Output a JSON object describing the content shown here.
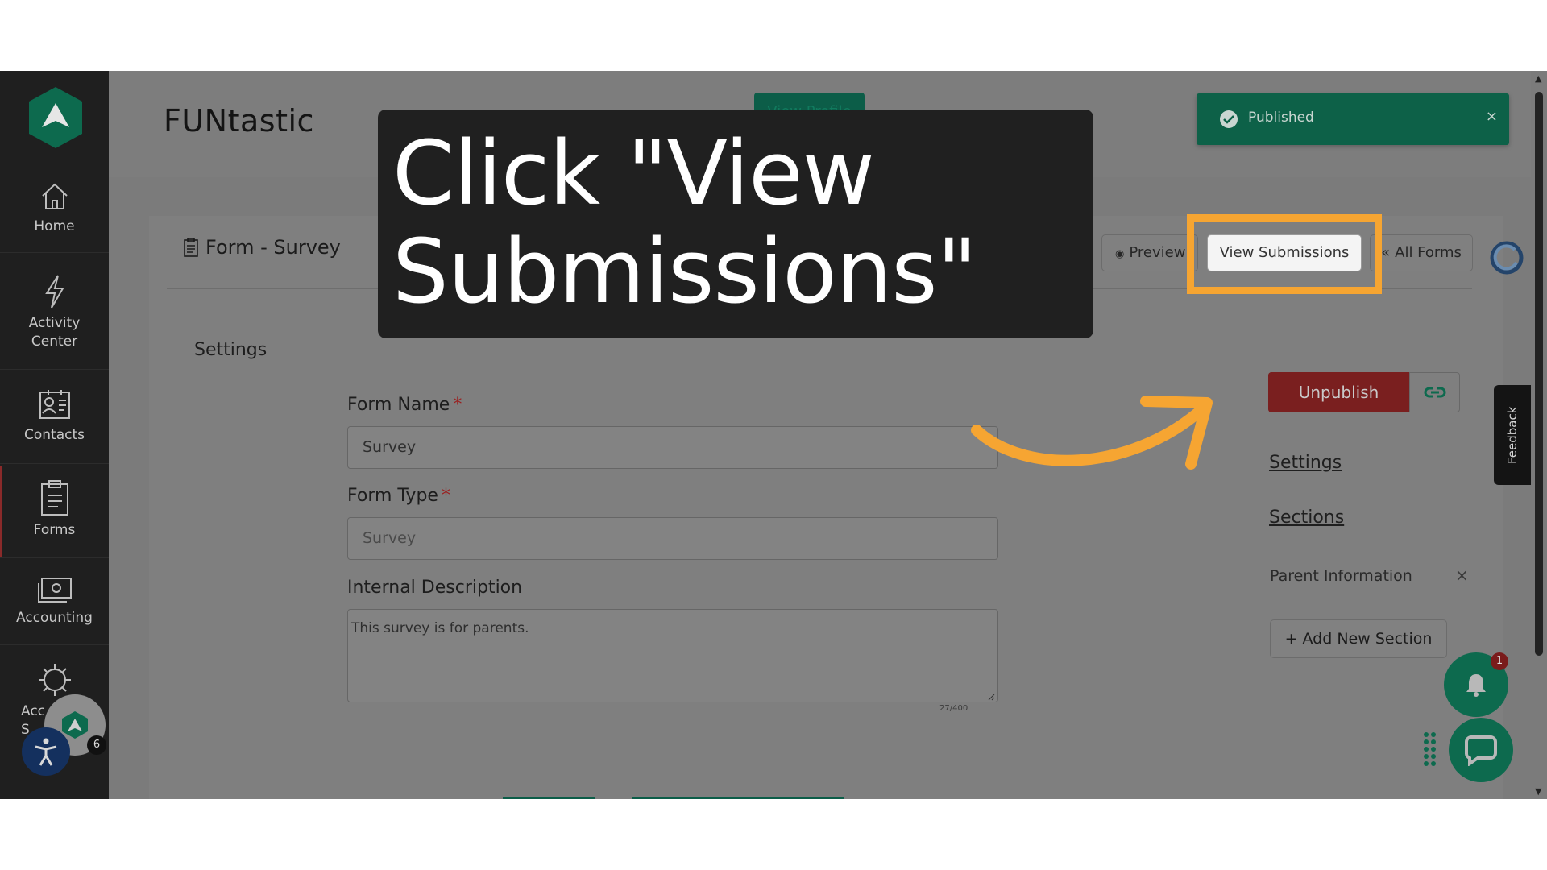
{
  "sidebar": {
    "items": [
      {
        "label": "Home",
        "icon": "home-icon"
      },
      {
        "label": "Activity\nCenter",
        "icon": "lightning-icon"
      },
      {
        "label": "Contacts",
        "icon": "contacts-icon"
      },
      {
        "label": "Forms",
        "icon": "clipboard-icon"
      },
      {
        "label": "Accounting",
        "icon": "cash-icon"
      },
      {
        "label": "Acc\nS",
        "icon": "gear-icon"
      }
    ]
  },
  "header": {
    "app_title": "FUNtastic",
    "view_profile_label": "View Profile"
  },
  "toast": {
    "text": "Published",
    "close": "×"
  },
  "form_header": {
    "title": "Form - Survey",
    "preview_label": "Preview",
    "view_submissions_label": "View Submissions",
    "all_forms_label": "All Forms"
  },
  "settings": {
    "heading": "Settings",
    "form_name_label": "Form Name",
    "form_name_value": "Survey",
    "form_type_label": "Form Type",
    "form_type_value": "Survey",
    "description_label": "Internal Description",
    "description_value": "This survey is for parents.",
    "char_count": "27/400",
    "required_mark": "*"
  },
  "right_panel": {
    "unpublish_label": "Unpublish",
    "settings_link": "Settings",
    "sections_link": "Sections",
    "section_item": "Parent Information",
    "section_remove": "×",
    "add_section_label": "+ Add New Section"
  },
  "feedback_label": "Feedback",
  "notifications_count": "1",
  "avatar_badge_count": "6",
  "instruction": {
    "text": "Click \"View Submissions\""
  },
  "colors": {
    "highlight": "#f6a532",
    "brand_green": "#117a5e",
    "unpublish_red": "#b22c2c"
  }
}
